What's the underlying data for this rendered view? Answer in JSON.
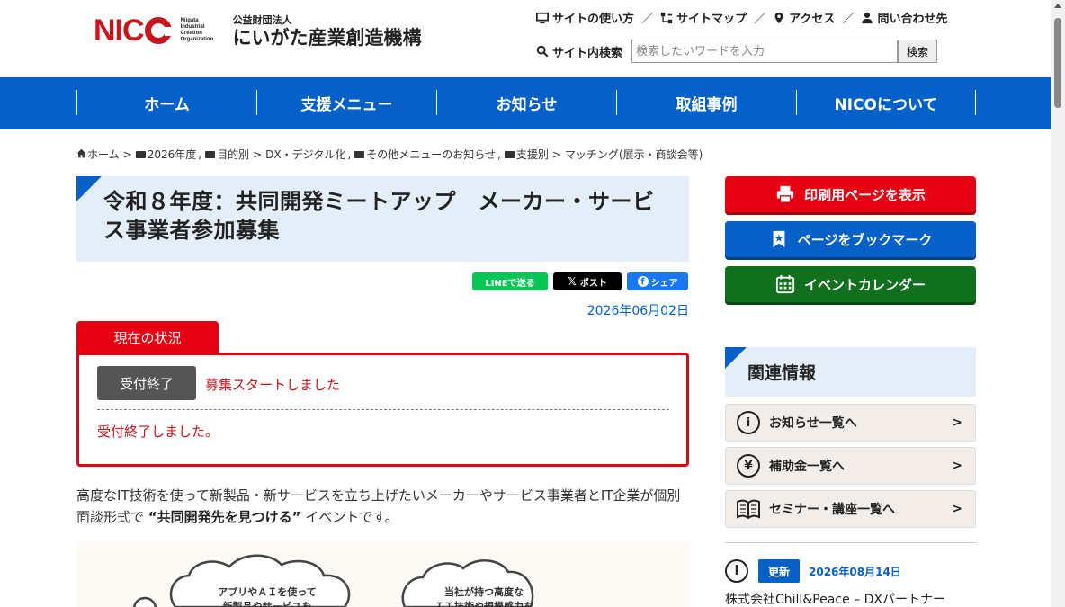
{
  "header": {
    "logo_nico": "NIC",
    "logo_small": "Niigata Industrial Creation Organization",
    "org_type": "公益財団法人",
    "org_name": "にいがた産業創造機構",
    "util_links": [
      "サイトの使い方",
      "サイトマップ",
      "アクセス",
      "問い合わせ先"
    ],
    "search_label": "サイト内検索",
    "search_placeholder": "検索したいワードを入力",
    "search_button": "検索"
  },
  "nav": {
    "items": [
      "ホーム",
      "支援メニュー",
      "お知らせ",
      "取組事例",
      "NICOについて"
    ]
  },
  "breadcrumb": {
    "home": "ホーム",
    "sep": ">",
    "cat1": "2026年度",
    "cat2": "目的別",
    "cat3": "DX・デジタル化",
    "cat4": "その他メニューのお知らせ",
    "cat5": "支援別",
    "cat6": "マッチング(展示・商談会等)"
  },
  "article": {
    "title": "令和８年度：共同開発ミートアップ　メーカー・サービス事業者参加募集",
    "share_line": "LINEで送る",
    "share_x": "ポスト",
    "share_fb": "シェア",
    "date": "2026年06月02日",
    "status_tab": "現在の状況",
    "status_button": "受付終了",
    "status_start": "募集スタートしました",
    "status_done": "受付終了しました。",
    "intro_1": "高度なIT技術を使って新製品・新サービスを立ち上げたいメーカーやサービス事業者とIT企業が個別面談形式で ",
    "intro_bold": "“共同開発先を見つける”",
    "intro_2": " イベントです。",
    "illus_text_1": "アプリやＡＩを使って",
    "illus_text_1b": "新製品やサービスを",
    "illus_text_2": "当社が持つ高度な",
    "illus_text_2b": "ＩＴ技術や規模感力を"
  },
  "sidebar": {
    "print_button": "印刷用ページを表示",
    "bookmark_button": "ページをブックマーク",
    "calendar_button": "イベントカレンダー",
    "related_title": "関連情報",
    "related_links": [
      {
        "label": "お知らせ一覧へ",
        "icon": "i"
      },
      {
        "label": "補助金一覧へ",
        "icon": "¥"
      },
      {
        "label": "セミナー・講座一覧へ",
        "icon": "book"
      }
    ],
    "news_badge": "更新",
    "news_date": "2026年08月14日",
    "news_title": "株式会社Chill&Peace – DXパートナー"
  },
  "colors": {
    "brand_red": "#e50012",
    "brand_blue": "#0560c8",
    "green": "#10701e"
  }
}
